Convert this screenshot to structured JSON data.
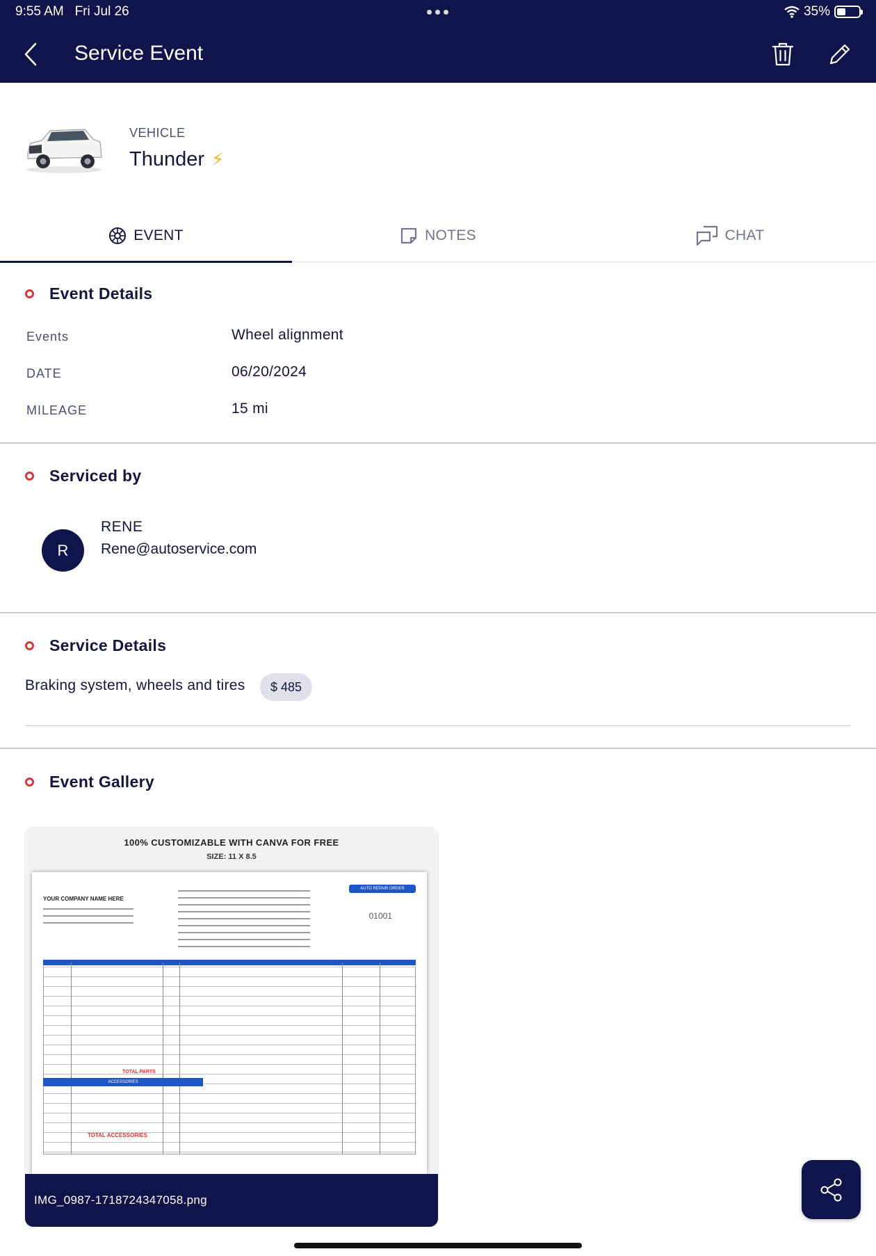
{
  "status_bar": {
    "time": "9:55 AM",
    "date": "Fri Jul 26",
    "battery": "35%"
  },
  "header": {
    "title": "Service Event"
  },
  "vehicle": {
    "label": "VEHICLE",
    "name": "Thunder"
  },
  "tabs": [
    {
      "label": "EVENT",
      "active": true
    },
    {
      "label": "NOTES",
      "active": false
    },
    {
      "label": "CHAT",
      "active": false
    }
  ],
  "event_details": {
    "heading": "Event Details",
    "rows": [
      {
        "label": "Events",
        "value": "Wheel alignment"
      },
      {
        "label": "DATE",
        "value": "06/20/2024"
      },
      {
        "label": "MILEAGE",
        "value": "15 mi"
      }
    ]
  },
  "serviced_by": {
    "heading": "Serviced by",
    "avatar_initial": "R",
    "name": "RENE",
    "email": "Rene@autoservice.com"
  },
  "service_details": {
    "heading": "Service Details",
    "description": "Braking system, wheels and tires",
    "price": "$ 485"
  },
  "gallery": {
    "heading": "Event Gallery",
    "image": {
      "filename": "IMG_0987-1718724347058.png",
      "title_line": "100% CUSTOMIZABLE WITH CANVA FOR FREE",
      "size_line": "SIZE: 11 X 8.5",
      "company": "YOUR COMPANY NAME HERE",
      "badge": "AUTO REPAIR ORDER",
      "number": "01001",
      "accessories": "ACCESSORIES",
      "total_parts": "TOTAL PARTS",
      "total_accessories": "TOTAL ACCESSORIES"
    }
  },
  "colors": {
    "primary": "#0f144a",
    "accent_ring": "#d23b3b",
    "bolt": "#f2b51e"
  }
}
